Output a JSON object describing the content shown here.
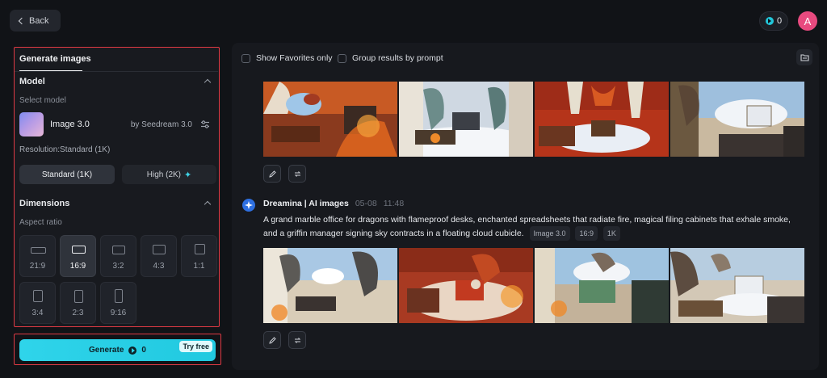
{
  "header": {
    "back_label": "Back",
    "credits": "0",
    "avatar_letter": "A"
  },
  "left_panel": {
    "tab_label": "Generate images",
    "model_section": {
      "title": "Model",
      "select_label": "Select model",
      "model_name": "Image 3.0",
      "model_by": "by Seedream 3.0"
    },
    "resolution": {
      "label": "Resolution:Standard (1K)",
      "options": [
        "Standard (1K)",
        "High (2K)"
      ],
      "selected": "Standard (1K)"
    },
    "dimensions": {
      "title": "Dimensions",
      "aspect_label": "Aspect ratio",
      "ratios": [
        "21:9",
        "16:9",
        "3:2",
        "4:3",
        "1:1",
        "3:4",
        "2:3",
        "9:16"
      ],
      "selected": "16:9"
    }
  },
  "generate": {
    "label": "Generate",
    "cost": "0",
    "badge": "Try free"
  },
  "results": {
    "show_favorites": "Show Favorites only",
    "group_by_prompt": "Group results by prompt",
    "entry": {
      "author": "Dreamina | AI images",
      "date": "05-08",
      "time": "11:48",
      "prompt": "A grand marble office for dragons with flameproof desks, enchanted spreadsheets that radiate fire, magical filing cabinets that exhale smoke, and a griffin manager signing sky contracts in a floating cloud cubicle.",
      "tags": [
        "Image 3.0",
        "16:9",
        "1K"
      ]
    }
  },
  "colors": {
    "accent": "#21c9e0",
    "highlight_border": "#e03a44",
    "avatar": "#e84a7f"
  }
}
